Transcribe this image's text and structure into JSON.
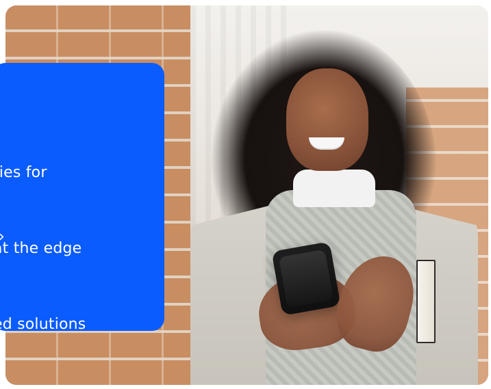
{
  "overlay_card": {
    "text_lines": [
      "ties for",
      "at the edge",
      "ed solutions"
    ],
    "arrow": "›"
  },
  "colors": {
    "panel": "#0b5cff",
    "text": "#ffffff"
  }
}
